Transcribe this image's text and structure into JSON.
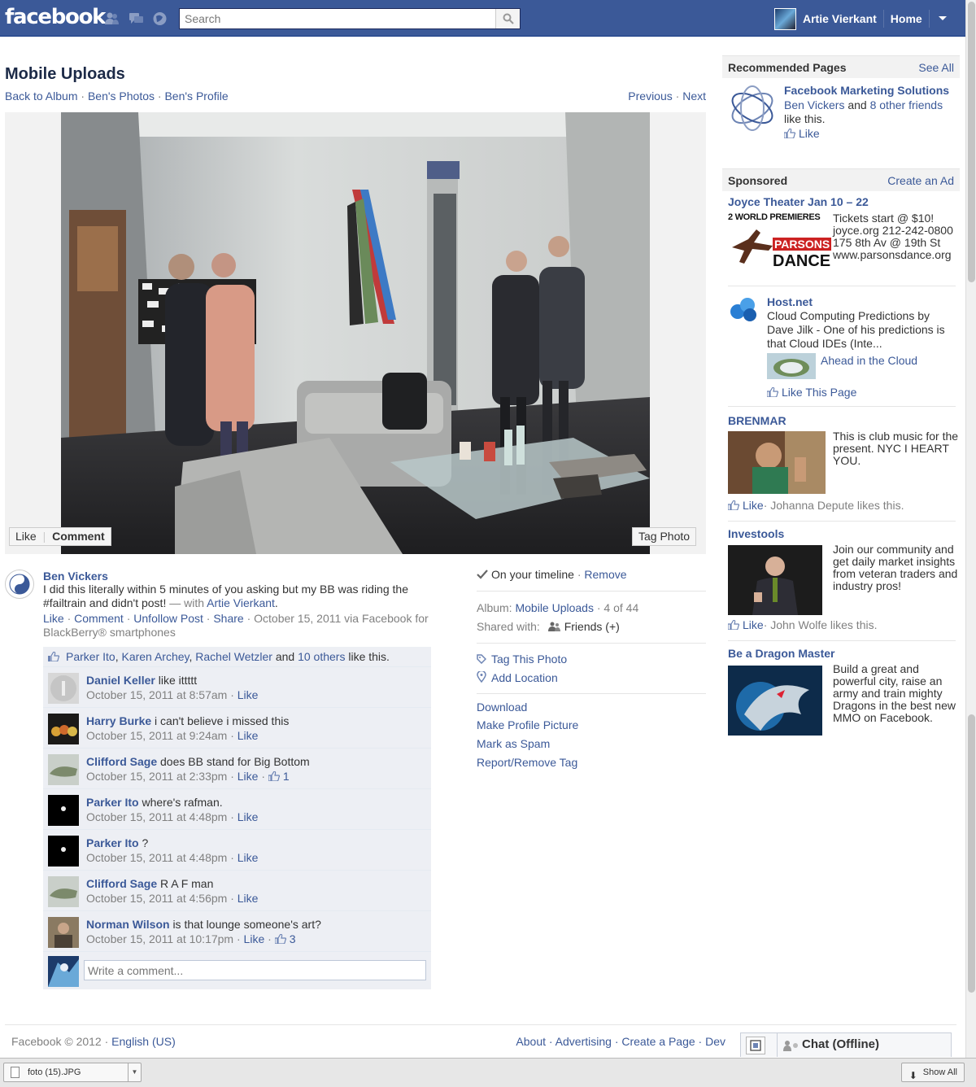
{
  "topbar": {
    "logo": "facebook",
    "search_placeholder": "Search",
    "user_name": "Artie Vierkant",
    "home_label": "Home",
    "icons": [
      "friend-requests-icon",
      "messages-icon",
      "notifications-icon",
      "search-icon",
      "account-menu-icon"
    ]
  },
  "page": {
    "title": "Mobile Uploads",
    "breadcrumb": {
      "back": "Back to Album",
      "photos": "Ben's Photos",
      "profile": "Ben's Profile",
      "sep": "·"
    },
    "previous": "Previous",
    "next": "Next"
  },
  "photo_actions": {
    "like": "Like",
    "comment": "Comment",
    "tag": "Tag Photo"
  },
  "post": {
    "author": "Ben Vickers",
    "message": "I did this literally within 5 minutes of you asking but my BB was riding the #failtrain and didn't post!",
    "with_prefix": " — with ",
    "with_name": "Artie Vierkant",
    "with_suffix": ".",
    "actions": {
      "like": "Like",
      "comment": "Comment",
      "unfollow": "Unfollow Post",
      "share": "Share"
    },
    "meta": "October 15, 2011 via Facebook for BlackBerry® smartphones"
  },
  "likes": {
    "names": [
      "Parker Ito",
      "Karen Archey",
      "Rachel Wetzler"
    ],
    "others": "10 others",
    "and": "and",
    "suffix": "like this."
  },
  "comments": [
    {
      "author": "Daniel Keller",
      "text": "like ittttt",
      "time": "October 15, 2011 at 8:57am",
      "like": "Like",
      "likes": ""
    },
    {
      "author": "Harry Burke",
      "text": "i can't believe i missed this",
      "time": "October 15, 2011 at 9:24am",
      "like": "Like",
      "likes": ""
    },
    {
      "author": "Clifford Sage",
      "text": "does BB stand for Big Bottom",
      "time": "October 15, 2011 at 2:33pm",
      "like": "Like",
      "likes": "1"
    },
    {
      "author": "Parker Ito",
      "text": "where's rafman.",
      "time": "October 15, 2011 at 4:48pm",
      "like": "Like",
      "likes": ""
    },
    {
      "author": "Parker Ito",
      "text": "?",
      "time": "October 15, 2011 at 4:48pm",
      "like": "Like",
      "likes": ""
    },
    {
      "author": "Clifford Sage",
      "text": "R A F man",
      "time": "October 15, 2011 at 4:56pm",
      "like": "Like",
      "likes": ""
    },
    {
      "author": "Norman Wilson",
      "text": "is that lounge someone's art?",
      "time": "October 15, 2011 at 10:17pm",
      "like": "Like",
      "likes": "3"
    }
  ],
  "comment_box": {
    "placeholder": "Write a comment..."
  },
  "info": {
    "timeline": "On your timeline",
    "remove": "Remove",
    "album_label": "Album:",
    "album_name": "Mobile Uploads",
    "album_pos": "· 4 of 44",
    "shared_label": "Shared with:",
    "shared_value": "Friends (+)",
    "tag_photo": "Tag This Photo",
    "add_location": "Add Location",
    "download": "Download",
    "profile_picture": "Make Profile Picture",
    "spam": "Mark as Spam",
    "report": "Report/Remove Tag"
  },
  "sidebar": {
    "recommended_title": "Recommended Pages",
    "see_all": "See All",
    "rec_page": {
      "name": "Facebook Marketing Solutions",
      "friend": "Ben Vickers",
      "and": "and",
      "others": "8 other friends",
      "suffix": "like this.",
      "like": "Like"
    },
    "sponsored_title": "Sponsored",
    "create_ad": "Create an Ad",
    "ads": [
      {
        "title": "Joyce Theater Jan 10 – 22",
        "image_text_1": "2 WORLD PREMIERES",
        "image_text_2": "PARSONS",
        "image_text_3": "DANCE",
        "body": "Tickets start @ $10! joyce.org 212-242-0800 175 8th Av @ 19th St www.parsonsdance.org"
      },
      {
        "title": "Host.net",
        "body": "Cloud Computing Predictions by Dave Jilk - One of his predictions is that Cloud IDEs (Inte...",
        "link": "Ahead in the Cloud",
        "like": "Like This Page"
      },
      {
        "title": "BRENMAR",
        "body": "This is club music for the present. NYC I HEART YOU.",
        "like": "Like",
        "social": "· Johanna Depute likes this."
      },
      {
        "title": "Investools",
        "body": "Join our community and get daily market insights from veteran traders and industry pros!",
        "like": "Like",
        "social": "· John Wolfe likes this."
      },
      {
        "title": "Be a Dragon Master",
        "body": "Build a great and powerful city, raise an army and train mighty Dragons in the best new MMO on Facebook."
      }
    ]
  },
  "footer": {
    "copyright": "Facebook © 2012 ·",
    "language": "English (US)",
    "links": "About · Advertising · Create a Page · Dev",
    "chat": "Chat (Offline)"
  },
  "downloads": {
    "file": "foto (15).JPG",
    "show_all": "Show All"
  },
  "colors": {
    "brand": "#3b5998",
    "link": "#3b5998",
    "ufi_bg": "#edeff4"
  }
}
